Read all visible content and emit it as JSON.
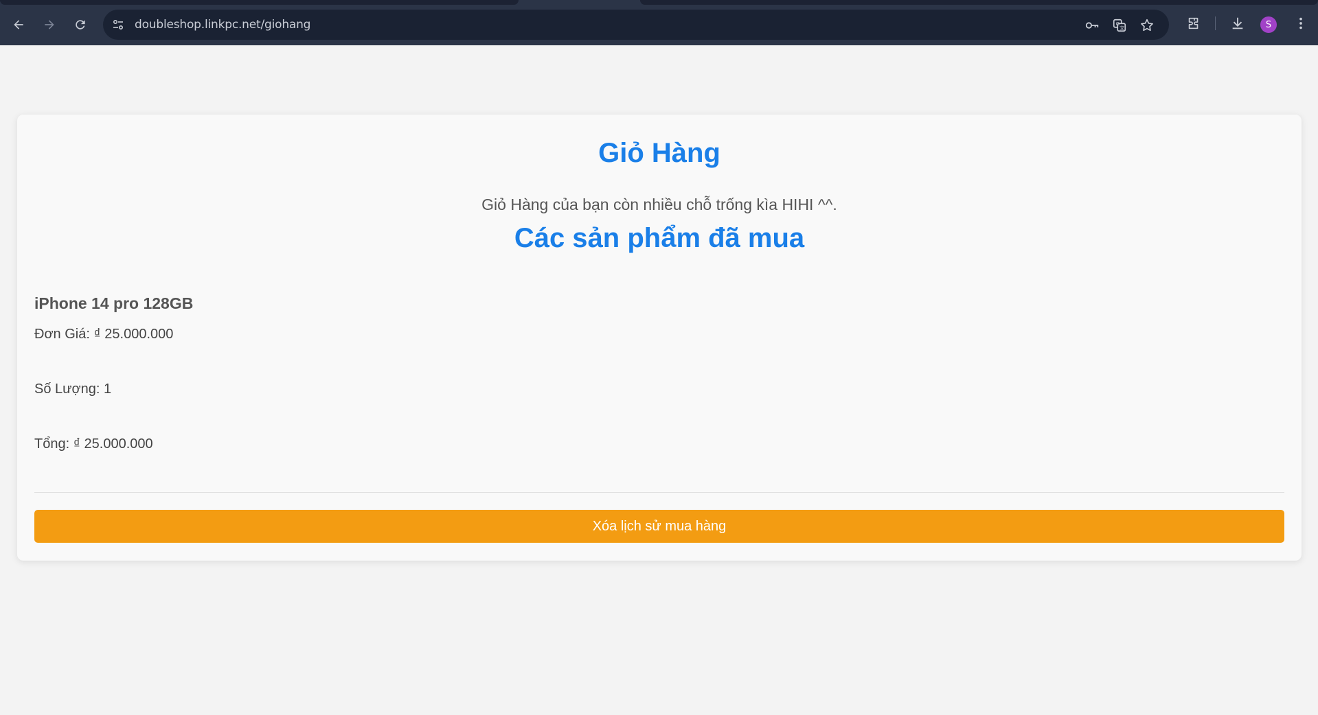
{
  "browser": {
    "url": "doubleshop.linkpc.net/giohang",
    "avatar_letter": "S",
    "icons": [
      "back-arrow-icon",
      "forward-arrow-icon",
      "reload-icon",
      "site-settings-icon",
      "password-key-icon",
      "translate-icon",
      "bookmark-star-icon",
      "extensions-icon",
      "download-icon",
      "menu-kebab-icon"
    ]
  },
  "page": {
    "title": "Giỏ Hàng",
    "subtitle": "Giỏ Hàng của bạn còn nhiều chỗ trống kìa HIHI ^^.",
    "section_title": "Các sản phẩm đã mua"
  },
  "product": {
    "name": "iPhone 14 pro 128GB",
    "unit_price": "Đơn Giá: ₫ 25.000.000",
    "quantity": "Số Lượng: 1",
    "total": "Tổng: ₫ 25.000.000"
  },
  "actions": {
    "clear_history_label": "Xóa lịch sử mua hàng"
  },
  "colors": {
    "accent_blue": "#1a7fe8",
    "button_orange": "#f39c12",
    "chrome_bg": "#2b3447"
  }
}
